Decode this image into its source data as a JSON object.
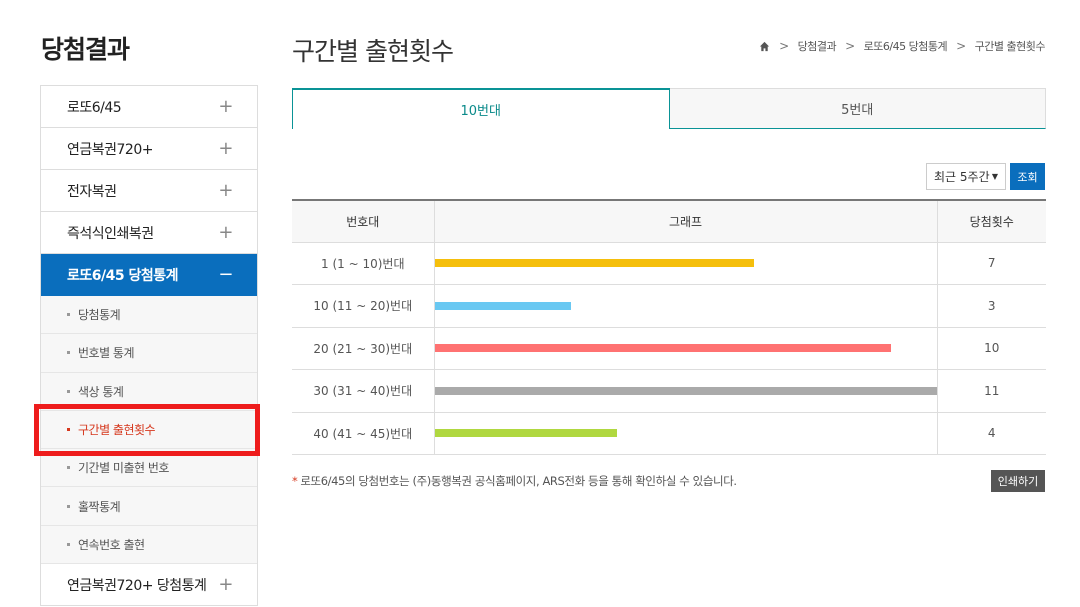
{
  "sidebar": {
    "title": "당첨결과",
    "items": [
      {
        "label": "로또6/45",
        "toggle": "+"
      },
      {
        "label": "연금복권720+",
        "toggle": "+"
      },
      {
        "label": "전자복권",
        "toggle": "+"
      },
      {
        "label": "즉석식인쇄복권",
        "toggle": "+"
      },
      {
        "label": "로또6/45 당첨통계",
        "toggle": "−"
      }
    ],
    "subitems": [
      "당첨통계",
      "번호별 통계",
      "색상 통계",
      "구간별 출현횟수",
      "기간별 미출현 번호",
      "홀짝통계",
      "연속번호 출현"
    ],
    "last_item": {
      "label": "연금복권720+ 당첨통계",
      "toggle": "+"
    }
  },
  "header": {
    "page_title": "구간별 출현횟수",
    "breadcrumb": [
      "당첨결과",
      "로또6/45 당첨통계",
      "구간별 출현횟수"
    ]
  },
  "tabs": [
    "10번대",
    "5번대"
  ],
  "filter": {
    "selected": "최근 5주간",
    "button": "조회"
  },
  "table": {
    "headers": [
      "번호대",
      "그래프",
      "당첨횟수"
    ],
    "max": 11,
    "rows": [
      {
        "range": "1 (1 ~ 10)번대",
        "count": 7,
        "count_label": "7",
        "color": "#f5bf0c"
      },
      {
        "range": "10 (11 ~ 20)번대",
        "count": 3,
        "count_label": "3",
        "color": "#69c8f2"
      },
      {
        "range": "20 (21 ~ 30)번대",
        "count": 10,
        "count_label": "10",
        "color": "#ff7272"
      },
      {
        "range": "30 (31 ~ 40)번대",
        "count": 11,
        "count_label": "11",
        "color": "#aaaaaa"
      },
      {
        "range": "40 (41 ~ 45)번대",
        "count": 4,
        "count_label": "4",
        "color": "#b0d840"
      }
    ]
  },
  "note": "로또6/45의 당첨번호는 (주)동행복권 공식홈페이지, ARS전화 등을 통해 확인하실 수 있습니다.",
  "print_label": "인쇄하기",
  "colors": {
    "primary": "#0a6ebd",
    "accent_red": "#d6381e",
    "tab_teal": "#0a9396"
  }
}
